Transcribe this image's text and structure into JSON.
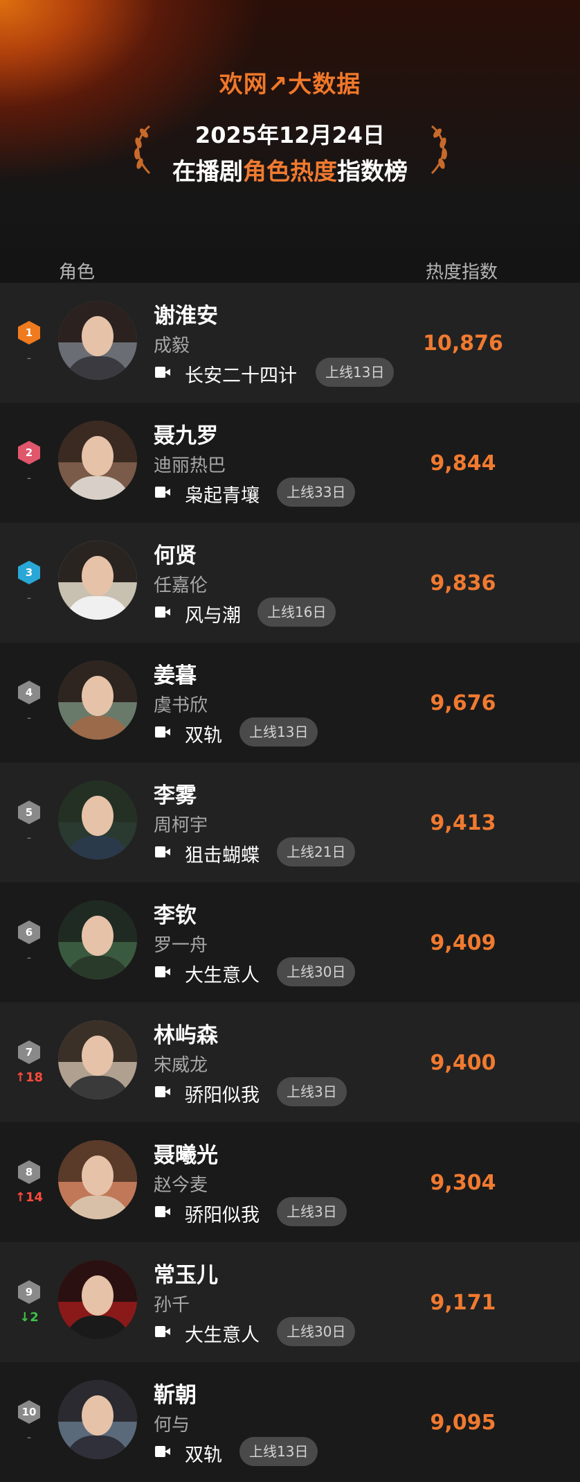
{
  "header": {
    "brand": "欢网↗大数据",
    "date": "2025年12月24日",
    "subtitle_pre": "在播剧",
    "subtitle_highlight": "角色热度",
    "subtitle_post": "指数榜"
  },
  "columns": {
    "role": "角色",
    "score": "热度指数"
  },
  "colors": {
    "accent": "#f07a30",
    "up": "#ff4a3a",
    "down": "#3fc24a"
  },
  "rows": [
    {
      "rank": "1",
      "change": "-",
      "role": "谢淮安",
      "actor": "成毅",
      "drama": "长安二十四计",
      "online": "上线13日",
      "score": "10,876"
    },
    {
      "rank": "2",
      "change": "-",
      "role": "聂九罗",
      "actor": "迪丽热巴",
      "drama": "枭起青壤",
      "online": "上线33日",
      "score": "9,844"
    },
    {
      "rank": "3",
      "change": "-",
      "role": "何贤",
      "actor": "任嘉伦",
      "drama": "风与潮",
      "online": "上线16日",
      "score": "9,836"
    },
    {
      "rank": "4",
      "change": "-",
      "role": "姜暮",
      "actor": "虞书欣",
      "drama": "双轨",
      "online": "上线13日",
      "score": "9,676"
    },
    {
      "rank": "5",
      "change": "-",
      "role": "李雾",
      "actor": "周柯宇",
      "drama": "狙击蝴蝶",
      "online": "上线21日",
      "score": "9,413"
    },
    {
      "rank": "6",
      "change": "-",
      "role": "李钦",
      "actor": "罗一舟",
      "drama": "大生意人",
      "online": "上线30日",
      "score": "9,409"
    },
    {
      "rank": "7",
      "change": "↑18",
      "role": "林屿森",
      "actor": "宋威龙",
      "drama": "骄阳似我",
      "online": "上线3日",
      "score": "9,400"
    },
    {
      "rank": "8",
      "change": "↑14",
      "role": "聂曦光",
      "actor": "赵今麦",
      "drama": "骄阳似我",
      "online": "上线3日",
      "score": "9,304"
    },
    {
      "rank": "9",
      "change": "↓2",
      "role": "常玉儿",
      "actor": "孙千",
      "drama": "大生意人",
      "online": "上线30日",
      "score": "9,171"
    },
    {
      "rank": "10",
      "change": "-",
      "role": "靳朝",
      "actor": "何与",
      "drama": "双轨",
      "online": "上线13日",
      "score": "9,095"
    }
  ]
}
